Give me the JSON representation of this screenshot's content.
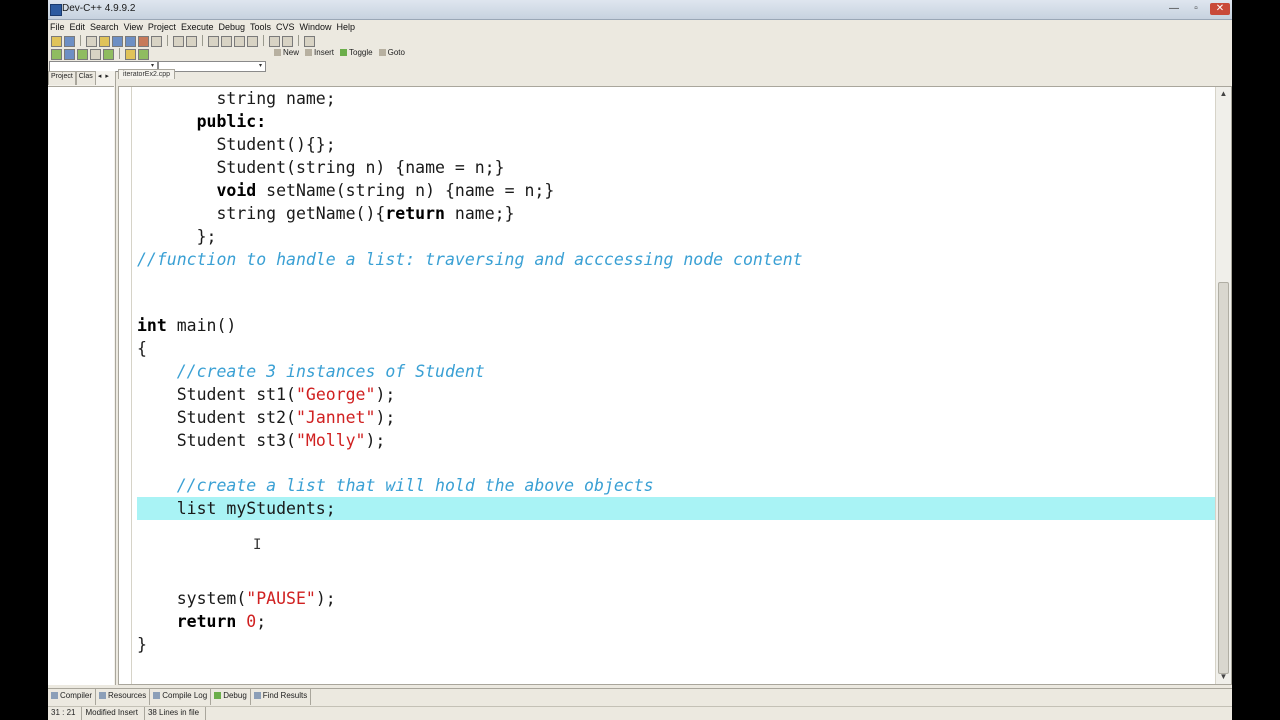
{
  "window": {
    "title": "Dev-C++ 4.9.9.2",
    "minimize": "—",
    "maximize": "▫",
    "close": "✕"
  },
  "menu": [
    "File",
    "Edit",
    "Search",
    "View",
    "Project",
    "Execute",
    "Debug",
    "Tools",
    "CVS",
    "Window",
    "Help"
  ],
  "bookmarks": {
    "new": "New",
    "insert": "Insert",
    "toggle": "Toggle",
    "goto": "Goto"
  },
  "left_panel": {
    "tab_project": "Project",
    "tab_classes": "Clas",
    "arrow_left": "◂",
    "arrow_right": "▸"
  },
  "editor": {
    "file_tab": "iteratorEx2.cpp",
    "highlight_line_index": 18
  },
  "bottom_tabs": [
    "Compiler",
    "Resources",
    "Compile Log",
    "Debug",
    "Find Results"
  ],
  "status": {
    "position": "31 : 21",
    "mode": "Modified\tInsert",
    "lines": "38 Lines in file"
  }
}
